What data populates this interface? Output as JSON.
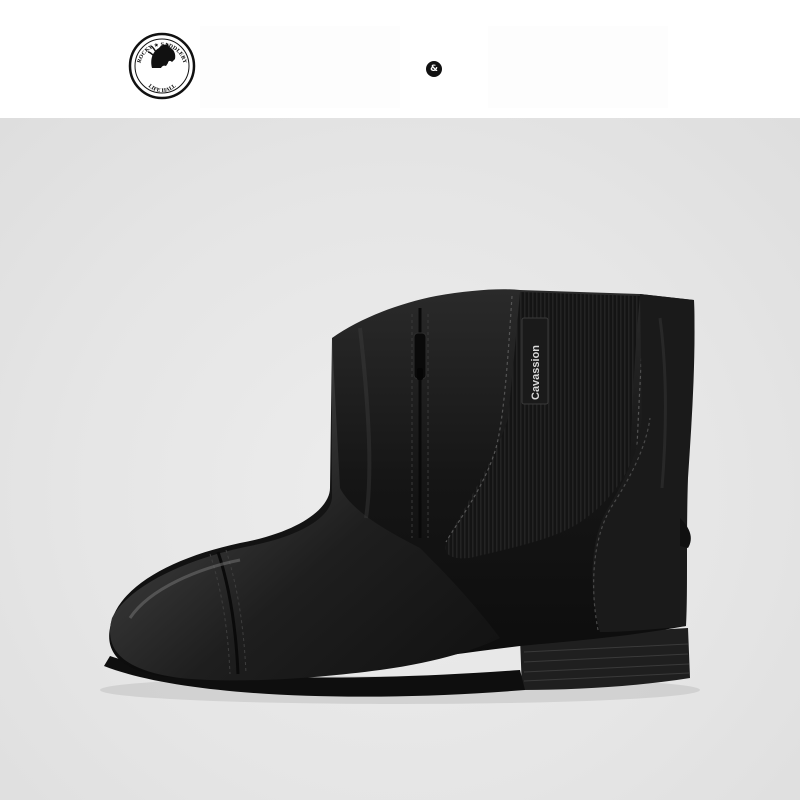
{
  "header": {
    "logo": {
      "top_text": "ROCKY ★ SADDLERY",
      "bottom_text": "LIFE HALL",
      "colors": {
        "ring": "#111111",
        "fill": "#ffffff"
      }
    },
    "ampersand_badge": "&"
  },
  "product": {
    "brand_tab_text": "Cavassion",
    "background_color": "#e6e6e6",
    "boot_color": "#161616"
  }
}
